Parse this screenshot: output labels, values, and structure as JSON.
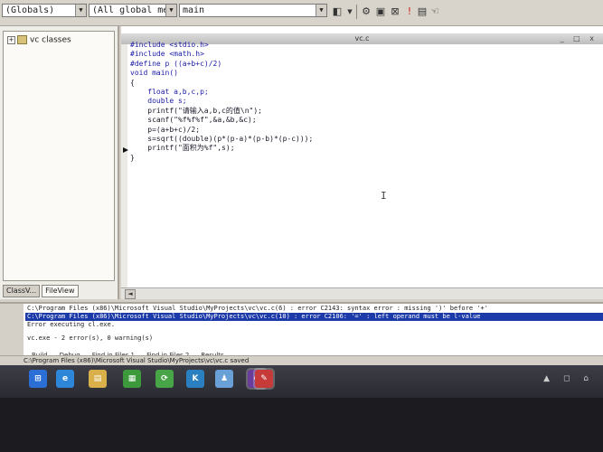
{
  "toolbar": {
    "scope_combo": "(Globals)",
    "members_combo": "(All global members",
    "function_combo": "main",
    "dropdown_arrow": "▼"
  },
  "workspace": {
    "tree_root": "vc classes",
    "expander": "+",
    "tabs": [
      "ClassV...",
      "FileView"
    ]
  },
  "editor": {
    "title": "vc.c",
    "window_controls": "_ □ x",
    "lines": [
      "#include <stdio.h>",
      "#include <math.h>",
      "#define p ((a+b+c)/2)",
      "void main()",
      "{",
      "    float a,b,c,p;",
      "    double s;",
      "    printf(\"请输入a,b,c的值\\n\");",
      "    scanf(\"%f%f%f\",&a,&b,&c);",
      "    p=(a+b+c)/2;",
      "    s=sqrt((double)(p*(p-a)*(p-b)*(p-c)));",
      "    printf(\"面积为%f\",s);",
      "}"
    ],
    "scroll_left": "◄"
  },
  "output": {
    "lines": [
      "C:\\Program Files (x86)\\Microsoft Visual Studio\\MyProjects\\vc\\vc.c(6) : error C2143: syntax error : missing ')' before '+'",
      "C:\\Program Files (x86)\\Microsoft Visual Studio\\MyProjects\\vc\\vc.c(10) : error C2106: '=' : left operand must be l-value",
      "Error executing cl.exe.",
      "vc.exe - 2 error(s), 0 warning(s)"
    ],
    "selected_index": 1,
    "tabs": [
      "Build",
      "Debug",
      "Find in Files 1",
      "Find in Files 2",
      "Results"
    ]
  },
  "status": {
    "text": "C:\\Program Files (x86)\\Microsoft Visual Studio\\MyProjects\\vc\\vc.c saved"
  },
  "taskbar": {
    "icons": [
      {
        "name": "windows-start-icon",
        "glyph": "⊞",
        "color": "#2b6fd6"
      },
      {
        "name": "internet-explorer-icon",
        "glyph": "e",
        "color": "#2d86d8"
      },
      {
        "name": "file-explorer-icon",
        "glyph": "▤",
        "color": "#d9b04a"
      },
      {
        "name": "app-green-icon",
        "glyph": "▦",
        "color": "#3c9a3c"
      },
      {
        "name": "sync-app-icon",
        "glyph": "⟳",
        "color": "#47a447"
      },
      {
        "name": "k-app-icon",
        "glyph": "K",
        "color": "#2a7fc0"
      },
      {
        "name": "qq-penguin-icon",
        "glyph": "♟",
        "color": "#6aa0d8"
      },
      {
        "name": "visual-studio-icon",
        "glyph": "∞",
        "color": "#6a3d9a"
      },
      {
        "name": "app-red-icon",
        "glyph": "✎",
        "color": "#c63a3a"
      }
    ]
  },
  "colors": {
    "keyword": "#1a1aa6",
    "selection": "#1c3aa8"
  }
}
